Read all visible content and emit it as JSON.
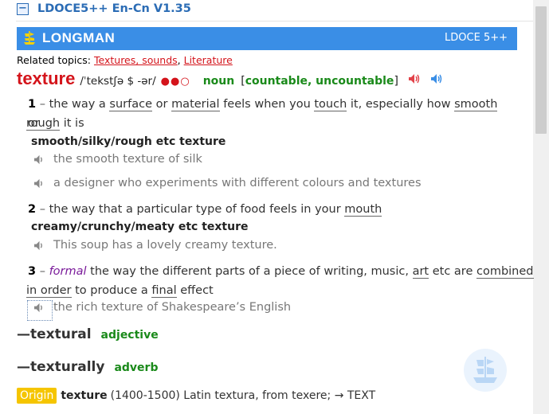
{
  "header": {
    "collapse_symbol": "−",
    "title": "LDOCE5++ En-Cn V1.35"
  },
  "banner": {
    "brand": "LONGMAN",
    "right_label": "LDOCE 5++",
    "logo_icon": "ship-icon",
    "background": "#3a8ee6"
  },
  "related": {
    "label": "Related topics:",
    "links": [
      "Textures, sounds",
      "Literature"
    ],
    "separator": ","
  },
  "entry": {
    "headword": "texture",
    "pronunciation": "/ˈtekstʃə $ -ər/",
    "frequency": "●●○",
    "pos": "noun",
    "grammar": "countable, uncountable",
    "grammar_open": "[",
    "grammar_close": "]"
  },
  "senses": [
    {
      "number": "1",
      "dash": "–",
      "def_parts": [
        "the way a ",
        "surface",
        " or ",
        "material",
        " feels when you ",
        "touch",
        " it, especially how ",
        "smooth",
        " or"
      ],
      "def_line2_parts": [
        "rough",
        " it is"
      ],
      "collocation": "smooth/silky/rough etc texture",
      "examples": [
        "the smooth texture of silk",
        "a designer who experiments with different colours and textures"
      ]
    },
    {
      "number": "2",
      "dash": "–",
      "def_parts": [
        "the way that a particular type of food feels in your ",
        "mouth"
      ],
      "collocation": "creamy/crunchy/meaty etc texture",
      "examples": [
        "This soup has a lovely creamy texture."
      ]
    },
    {
      "number": "3",
      "dash": "–",
      "register": "formal",
      "def_parts": [
        " the way the different parts of a piece of writing, music, ",
        "art",
        " etc are ",
        "combined"
      ],
      "def_line2_parts": [
        "in order",
        " to produce a ",
        "final",
        " effect"
      ],
      "examples": [
        "the rich texture of Shakespeare’s English"
      ]
    }
  ],
  "derivatives": [
    {
      "word": "—textural",
      "pos": "adjective"
    },
    {
      "word": "—texturally",
      "pos": "adverb"
    }
  ],
  "origin": {
    "badge": "Origin",
    "word": "texture",
    "text": "(1400-1500) Latin textura, from texere; → TEXT",
    "badge_color": "#f5c500"
  },
  "colors": {
    "headword": "#d4141b",
    "pos": "#1a8a1a",
    "title": "#2b6cb5"
  }
}
